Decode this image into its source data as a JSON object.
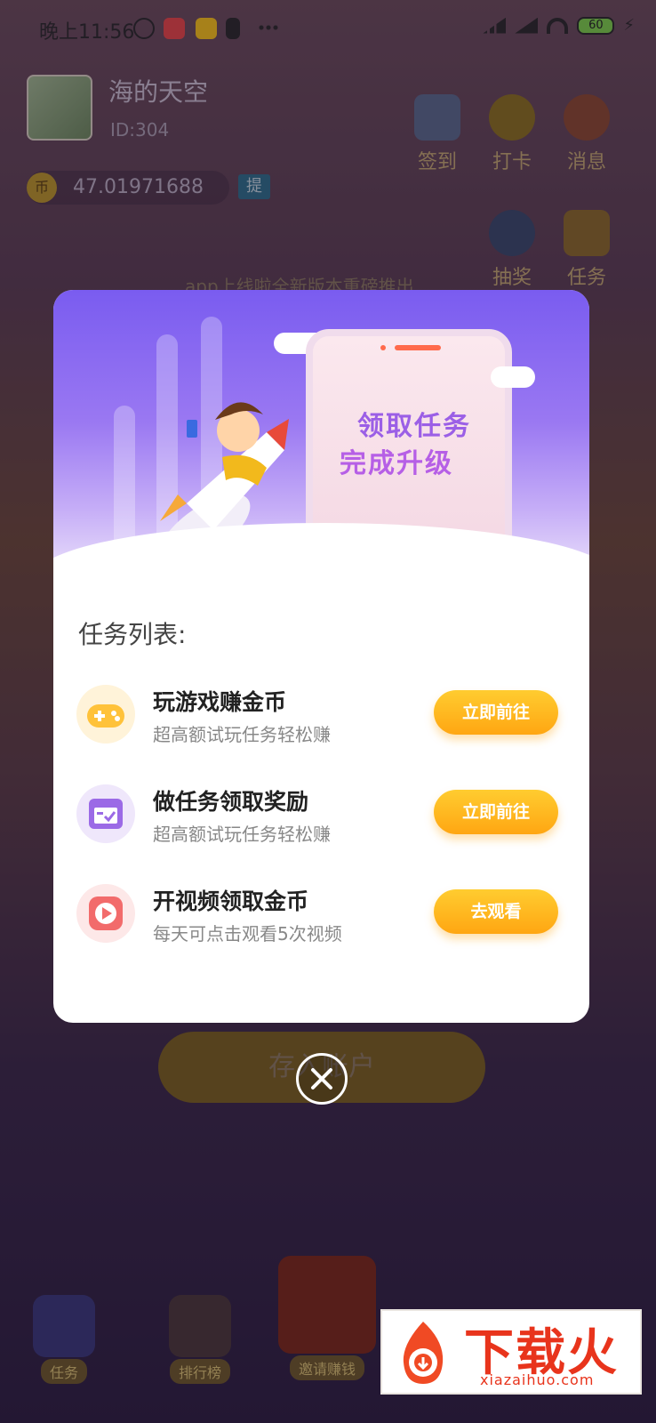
{
  "status_bar": {
    "time": "晚上11:56",
    "battery": "60"
  },
  "profile": {
    "name": "海的天空",
    "id": "ID:304",
    "coin_symbol": "币",
    "balance": "47.01971688",
    "withdraw_label": "提"
  },
  "side_buttons": [
    {
      "label": "签到",
      "icon": "calendar-sign-icon"
    },
    {
      "label": "打卡",
      "icon": "checkin-icon"
    },
    {
      "label": "消息",
      "icon": "mail-icon"
    },
    {
      "label": "抽奖",
      "icon": "lottery-wheel-icon"
    },
    {
      "label": "任务",
      "icon": "task-calendar-icon"
    }
  ],
  "marquee": "app上线啦全新版本重磅推出",
  "bottom_button": "存入账户",
  "nav": [
    {
      "label": "任务",
      "icon": "task-chest-icon"
    },
    {
      "label": "排行榜",
      "icon": "ranking-chart-icon"
    },
    {
      "label": "邀请赚钱",
      "icon": "red-envelope-icon"
    }
  ],
  "modal": {
    "hero_line1": "领取任务",
    "hero_line2": "完成升级",
    "list_title": "任务列表:",
    "tasks": [
      {
        "name": "玩游戏赚金币",
        "desc": "超高额试玩任务轻松赚",
        "button": "立即前往",
        "icon": "gamepad-icon"
      },
      {
        "name": "做任务领取奖励",
        "desc": "超高额试玩任务轻松赚",
        "button": "立即前往",
        "icon": "task-calendar-check-icon"
      },
      {
        "name": "开视频领取金币",
        "desc": "每天可点击观看5次视频",
        "button": "去观看",
        "icon": "video-play-icon"
      }
    ]
  },
  "watermark": {
    "title": "下载火",
    "url": "xiazaihuo.com"
  }
}
